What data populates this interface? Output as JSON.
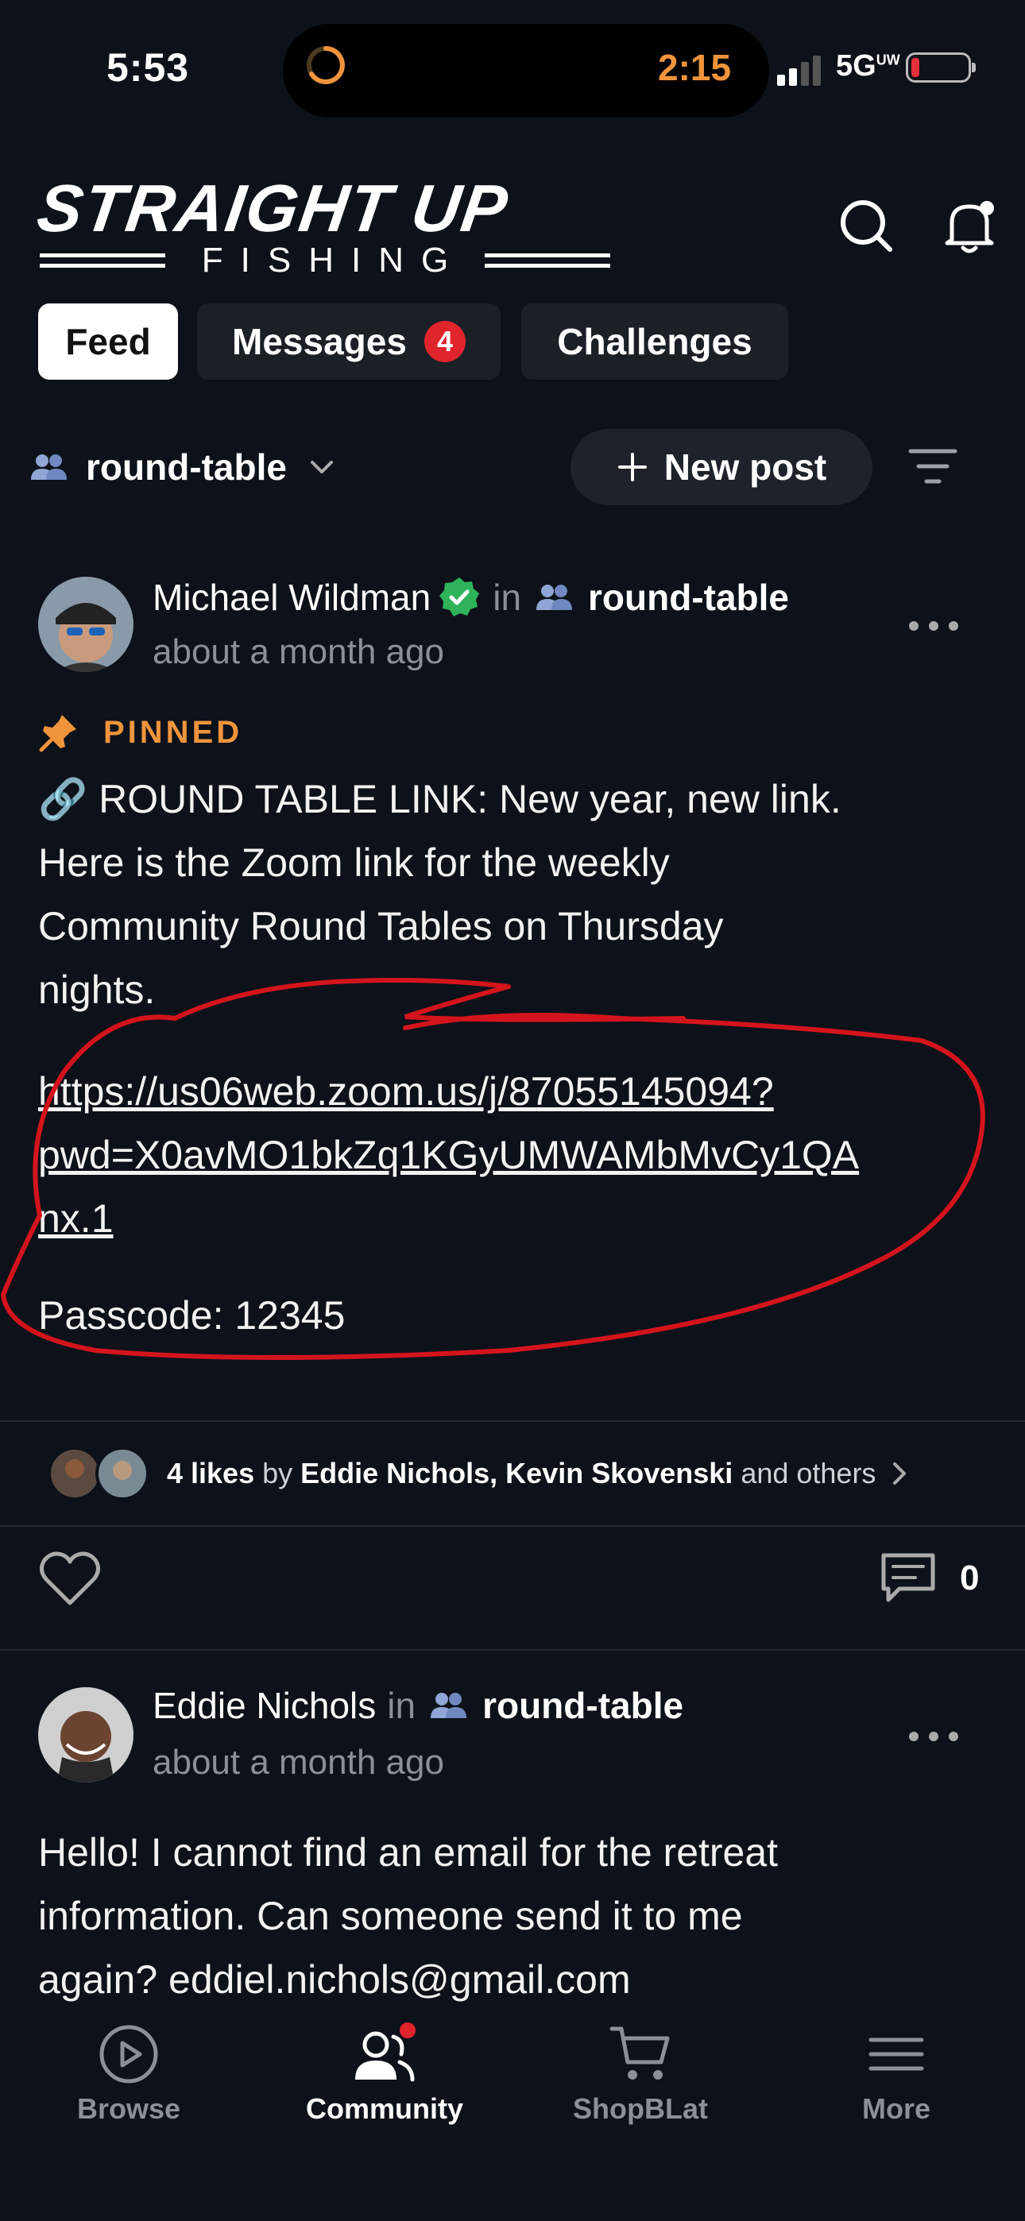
{
  "status": {
    "time": "5:53",
    "island_timer": "2:15",
    "network": "5G",
    "network_sup": "UW"
  },
  "header": {
    "logo_main": "STRAIGHT UP",
    "logo_sub": "FISHING"
  },
  "tabs": [
    {
      "label": "Feed",
      "active": true
    },
    {
      "label": "Messages",
      "badge": "4"
    },
    {
      "label": "Challenges"
    }
  ],
  "group": {
    "name": "round-table",
    "new_post": "New post"
  },
  "posts": [
    {
      "author": "Michael Wildman",
      "verified": true,
      "in": "in",
      "group": "round-table",
      "time": "about a month ago",
      "pinned_label": "PINNED",
      "body_lines": [
        "🔗  ROUND TABLE LINK: New year, new link.",
        "Here is the Zoom link for the weekly",
        "Community Round Tables on Thursday",
        "nights."
      ],
      "link_lines": [
        "https://us06web.zoom.us/j/87055145094?",
        "pwd=X0avMO1bkZq1KGyUMWAMbMvCy1QA",
        "nx.1"
      ],
      "passcode": "Passcode: 12345",
      "likes_count": "4 likes",
      "likes_by": "by",
      "likers": "Eddie Nichols, Kevin Skovenski",
      "likes_others": "and others",
      "comments": "0"
    },
    {
      "author": "Eddie Nichols",
      "in": "in",
      "group": "round-table",
      "time": "about a month ago",
      "body_lines": [
        "Hello! I cannot find an email for the retreat",
        "information. Can someone send it to me",
        "again? eddiel.nichols@gmail.com"
      ]
    }
  ],
  "nav": [
    {
      "label": "Browse",
      "icon": "play-circle-icon"
    },
    {
      "label": "Community",
      "icon": "community-icon",
      "active": true
    },
    {
      "label": "ShopBLat",
      "icon": "cart-icon"
    },
    {
      "label": "More",
      "icon": "menu-icon"
    }
  ],
  "colors": {
    "background": "#0d1119",
    "accent_orange": "#f0943c",
    "badge_red": "#e0242c",
    "verified_green": "#2fb35a",
    "annotation_red": "#d4141c"
  }
}
